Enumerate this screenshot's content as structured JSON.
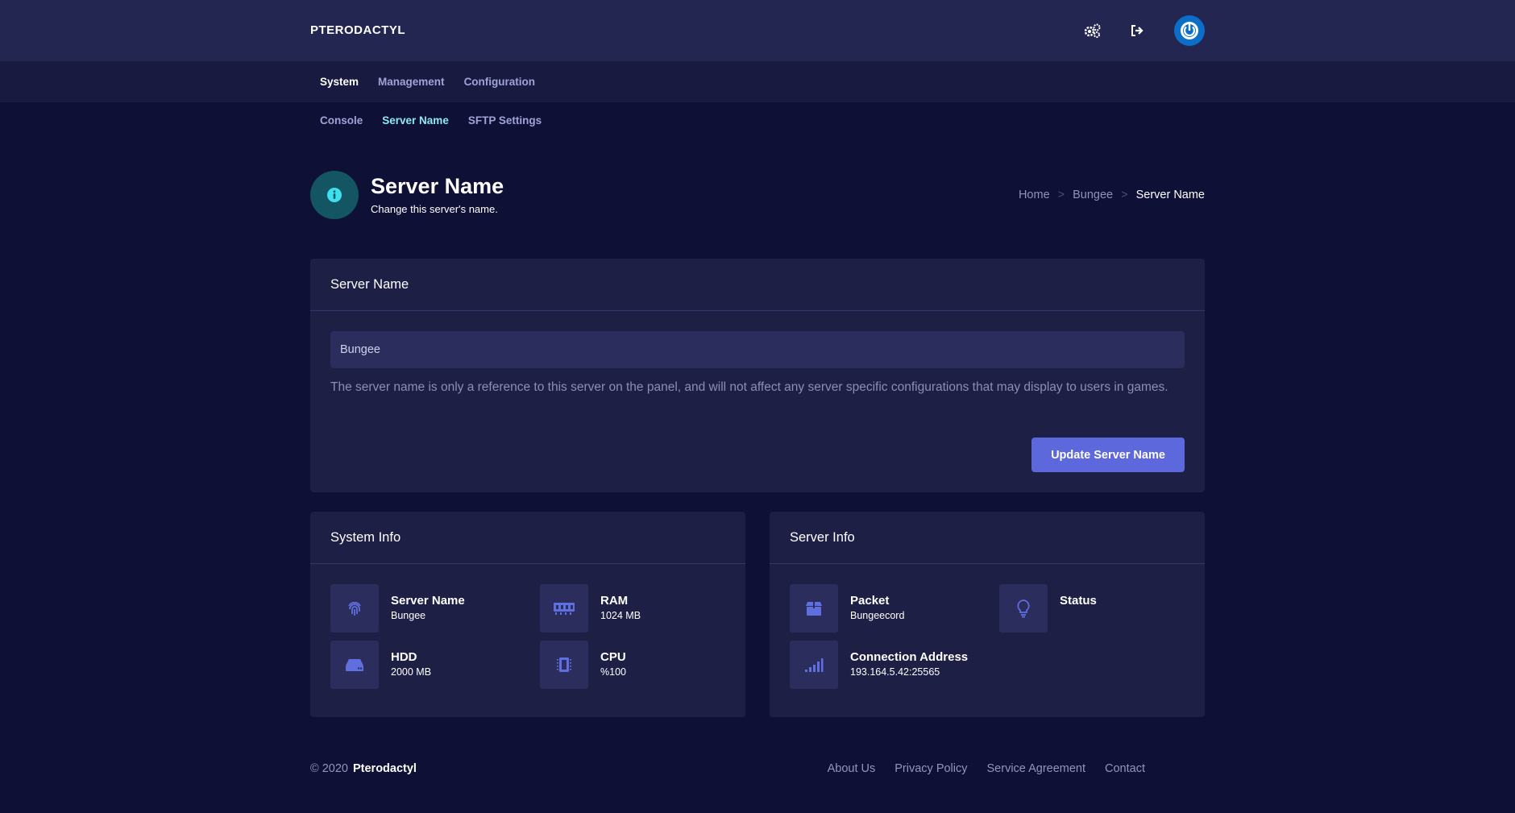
{
  "brand": "PTERODACTYL",
  "top_icons": [
    "gears-icon",
    "logout-icon",
    "power-icon"
  ],
  "nav": [
    "System",
    "Management",
    "Configuration"
  ],
  "subnav": [
    "Console",
    "Server Name",
    "SFTP Settings"
  ],
  "header": {
    "title": "Server Name",
    "subtitle": "Change this server's name."
  },
  "breadcrumb": {
    "items": [
      "Home",
      "Bungee",
      "Server Name"
    ],
    "separator": ">"
  },
  "server_name_card": {
    "title": "Server Name",
    "input_value": "Bungee",
    "help_text": "The server name is only a reference to this server on the panel, and will not affect any server specific configurations that may display to users in games.",
    "button_label": "Update Server Name"
  },
  "system_info": {
    "title": "System Info",
    "items": [
      {
        "label": "Server Name",
        "value": "Bungee",
        "icon": "fingerprint-icon"
      },
      {
        "label": "RAM",
        "value": "1024 MB",
        "icon": "memory-icon"
      },
      {
        "label": "HDD",
        "value": "2000 MB",
        "icon": "hdd-icon"
      },
      {
        "label": "CPU",
        "value": "%100",
        "icon": "cpu-icon"
      }
    ]
  },
  "server_info": {
    "title": "Server Info",
    "items": [
      {
        "label": "Packet",
        "value": "Bungeecord",
        "icon": "box-icon"
      },
      {
        "label": "Status",
        "value": "",
        "icon": "lightbulb-icon"
      },
      {
        "label": "Connection Address",
        "value": "193.164.5.42:25565",
        "icon": "signal-icon"
      }
    ]
  },
  "footer": {
    "copyright_prefix": "© 2020",
    "copyright_brand": "Pterodactyl",
    "links": [
      "About Us",
      "Privacy Policy",
      "Service Agreement",
      "Contact"
    ]
  },
  "colors": {
    "background": "#0f1035",
    "topbar": "#232650",
    "card": "#1d1f45",
    "accent": "#5c68dc",
    "active_subnav": "#8ee9f1",
    "icon_blue": "#5f6fe0"
  }
}
